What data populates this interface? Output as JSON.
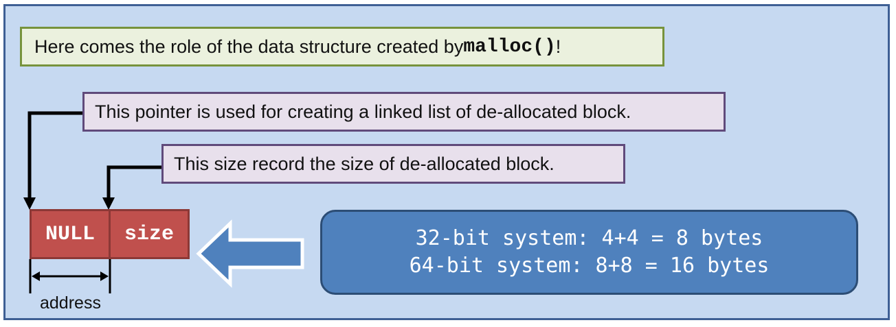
{
  "title": {
    "prefix": "Here comes the role of the data structure created by ",
    "code": "malloc()",
    "suffix": "!"
  },
  "notes": {
    "pointer": "This pointer is used for creating a linked list of de-allocated block.",
    "size": "This size record the size of de-allocated block."
  },
  "block": {
    "null_label": "NULL",
    "size_label": "size",
    "address_label": "address"
  },
  "info": {
    "line1": "32-bit system: 4+4 = 8 bytes",
    "line2": "64-bit system: 8+8 = 16 bytes"
  },
  "colors": {
    "frame_fill": "#c6d9f1",
    "cell_fill": "#c0504d",
    "info_fill": "#4f81bd",
    "arrow_fill": "#4f81bd"
  }
}
